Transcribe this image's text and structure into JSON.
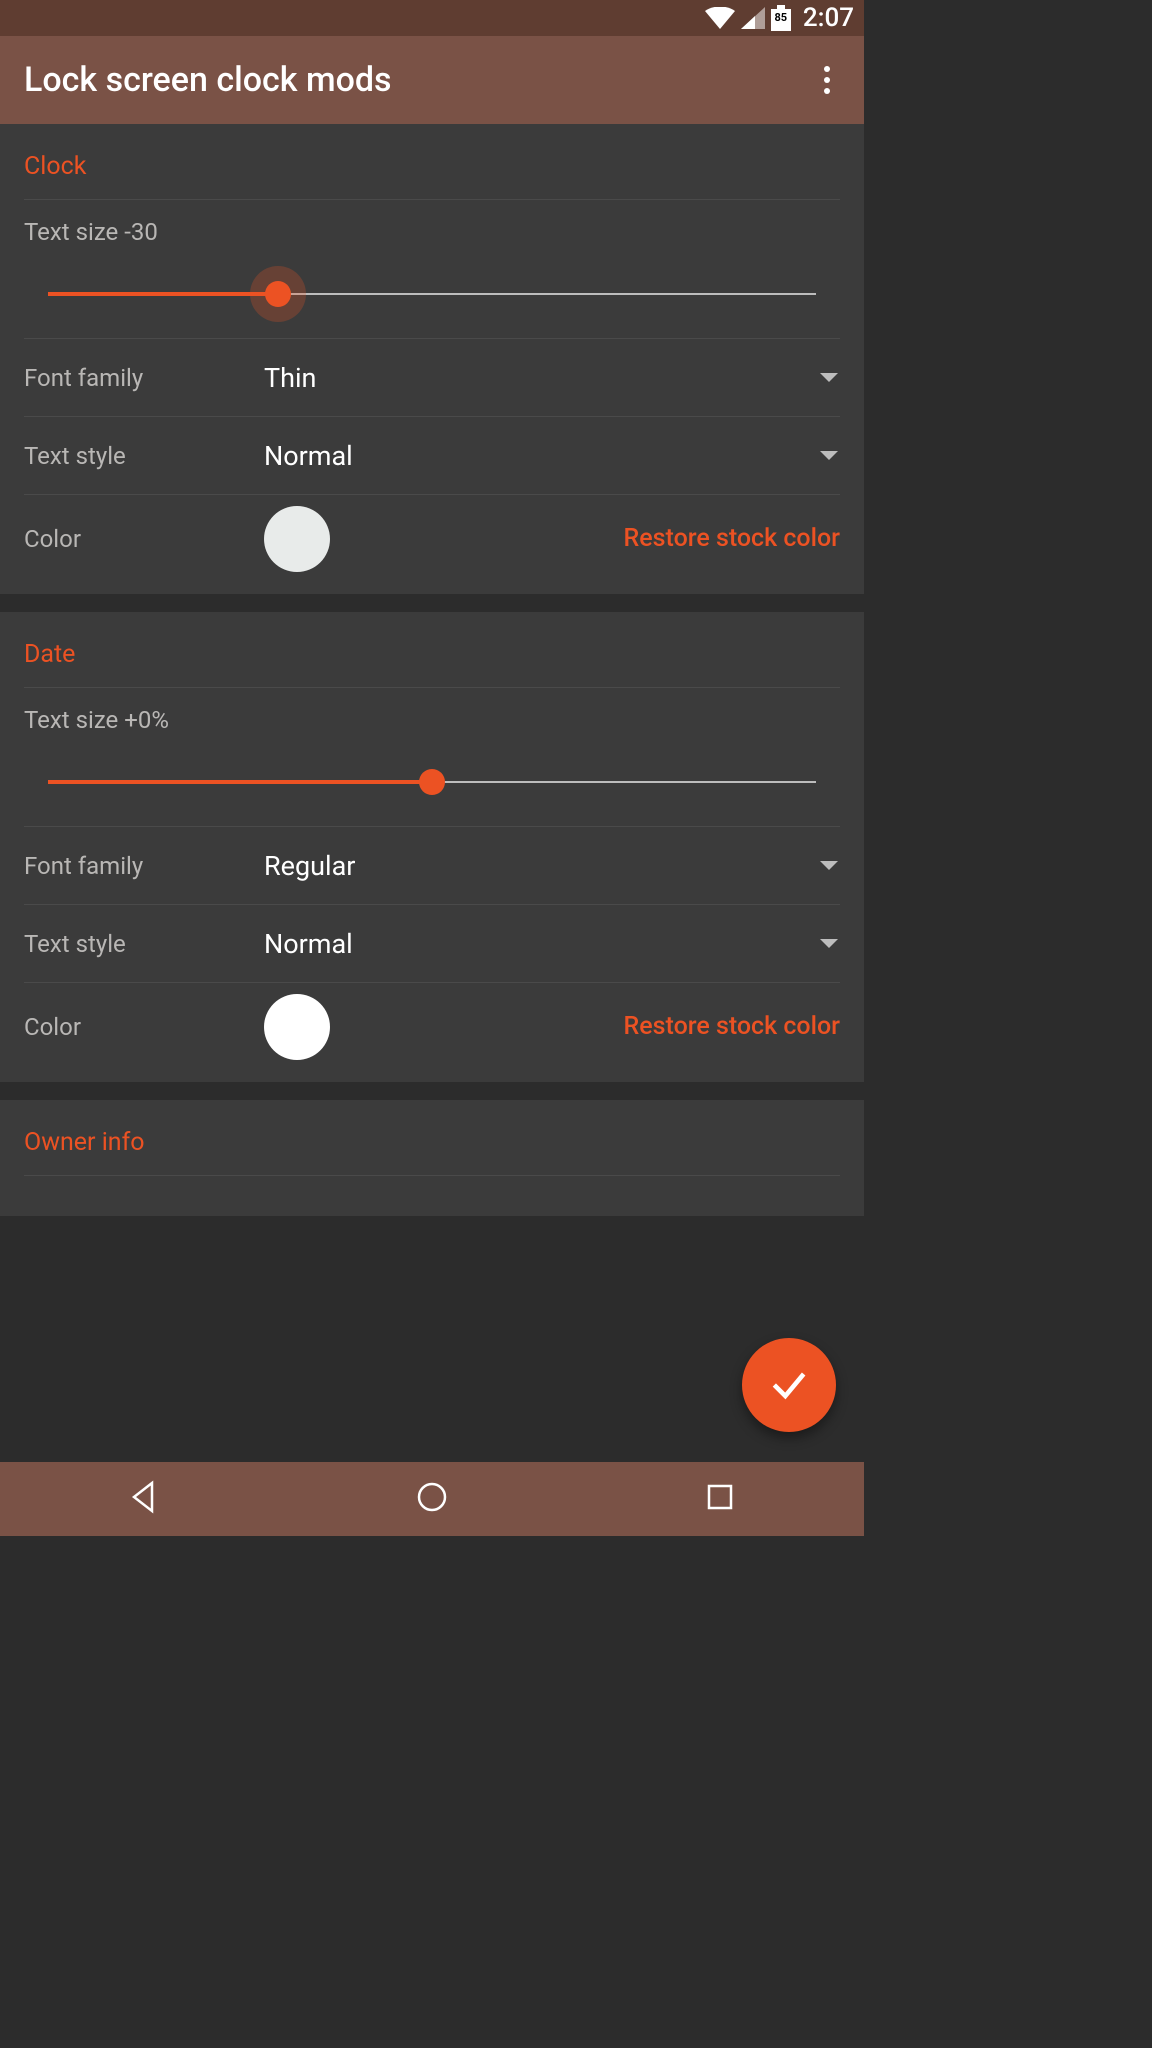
{
  "status": {
    "battery": "85",
    "time": "2:07"
  },
  "appbar": {
    "title": "Lock screen clock mods"
  },
  "sections": {
    "clock": {
      "title": "Clock",
      "text_size_label": "Text size -30",
      "text_size_percent": 30,
      "font_family_label": "Font family",
      "font_family_value": "Thin",
      "text_style_label": "Text style",
      "text_style_value": "Normal",
      "color_label": "Color",
      "color_value": "#e8ebea",
      "restore_label": "Restore stock color"
    },
    "date": {
      "title": "Date",
      "text_size_label": "Text size +0%",
      "text_size_percent": 50,
      "font_family_label": "Font family",
      "font_family_value": "Regular",
      "text_style_label": "Text style",
      "text_style_value": "Normal",
      "color_label": "Color",
      "color_value": "#ffffff",
      "restore_label": "Restore stock color"
    },
    "owner": {
      "title": "Owner info"
    }
  }
}
